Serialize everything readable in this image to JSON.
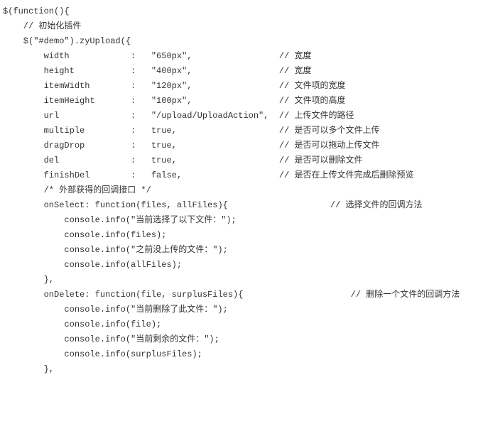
{
  "code_lines": [
    "$(function(){",
    "    // 初始化插件",
    "    $(\"#demo\").zyUpload({",
    "        width            :   \"650px\",                 // 宽度",
    "        height           :   \"400px\",                 // 宽度",
    "        itemWidth        :   \"120px\",                 // 文件项的宽度",
    "        itemHeight       :   \"100px\",                 // 文件项的高度",
    "        url              :   \"/upload/UploadAction\",  // 上传文件的路径",
    "        multiple         :   true,                    // 是否可以多个文件上传",
    "        dragDrop         :   true,                    // 是否可以拖动上传文件",
    "        del              :   true,                    // 是否可以删除文件",
    "        finishDel        :   false,                   // 是否在上传文件完成后删除预览",
    "        /* 外部获得的回调接口 */",
    "        onSelect: function(files, allFiles){                    // 选择文件的回调方法",
    "            console.info(\"当前选择了以下文件：\");",
    "            console.info(files);",
    "            console.info(\"之前没上传的文件：\");",
    "            console.info(allFiles);",
    "        },",
    "        onDelete: function(file, surplusFiles){                     // 删除一个文件的回调方法",
    "            console.info(\"当前删除了此文件：\");",
    "            console.info(file);",
    "            console.info(\"当前剩余的文件：\");",
    "            console.info(surplusFiles);",
    "        },"
  ]
}
